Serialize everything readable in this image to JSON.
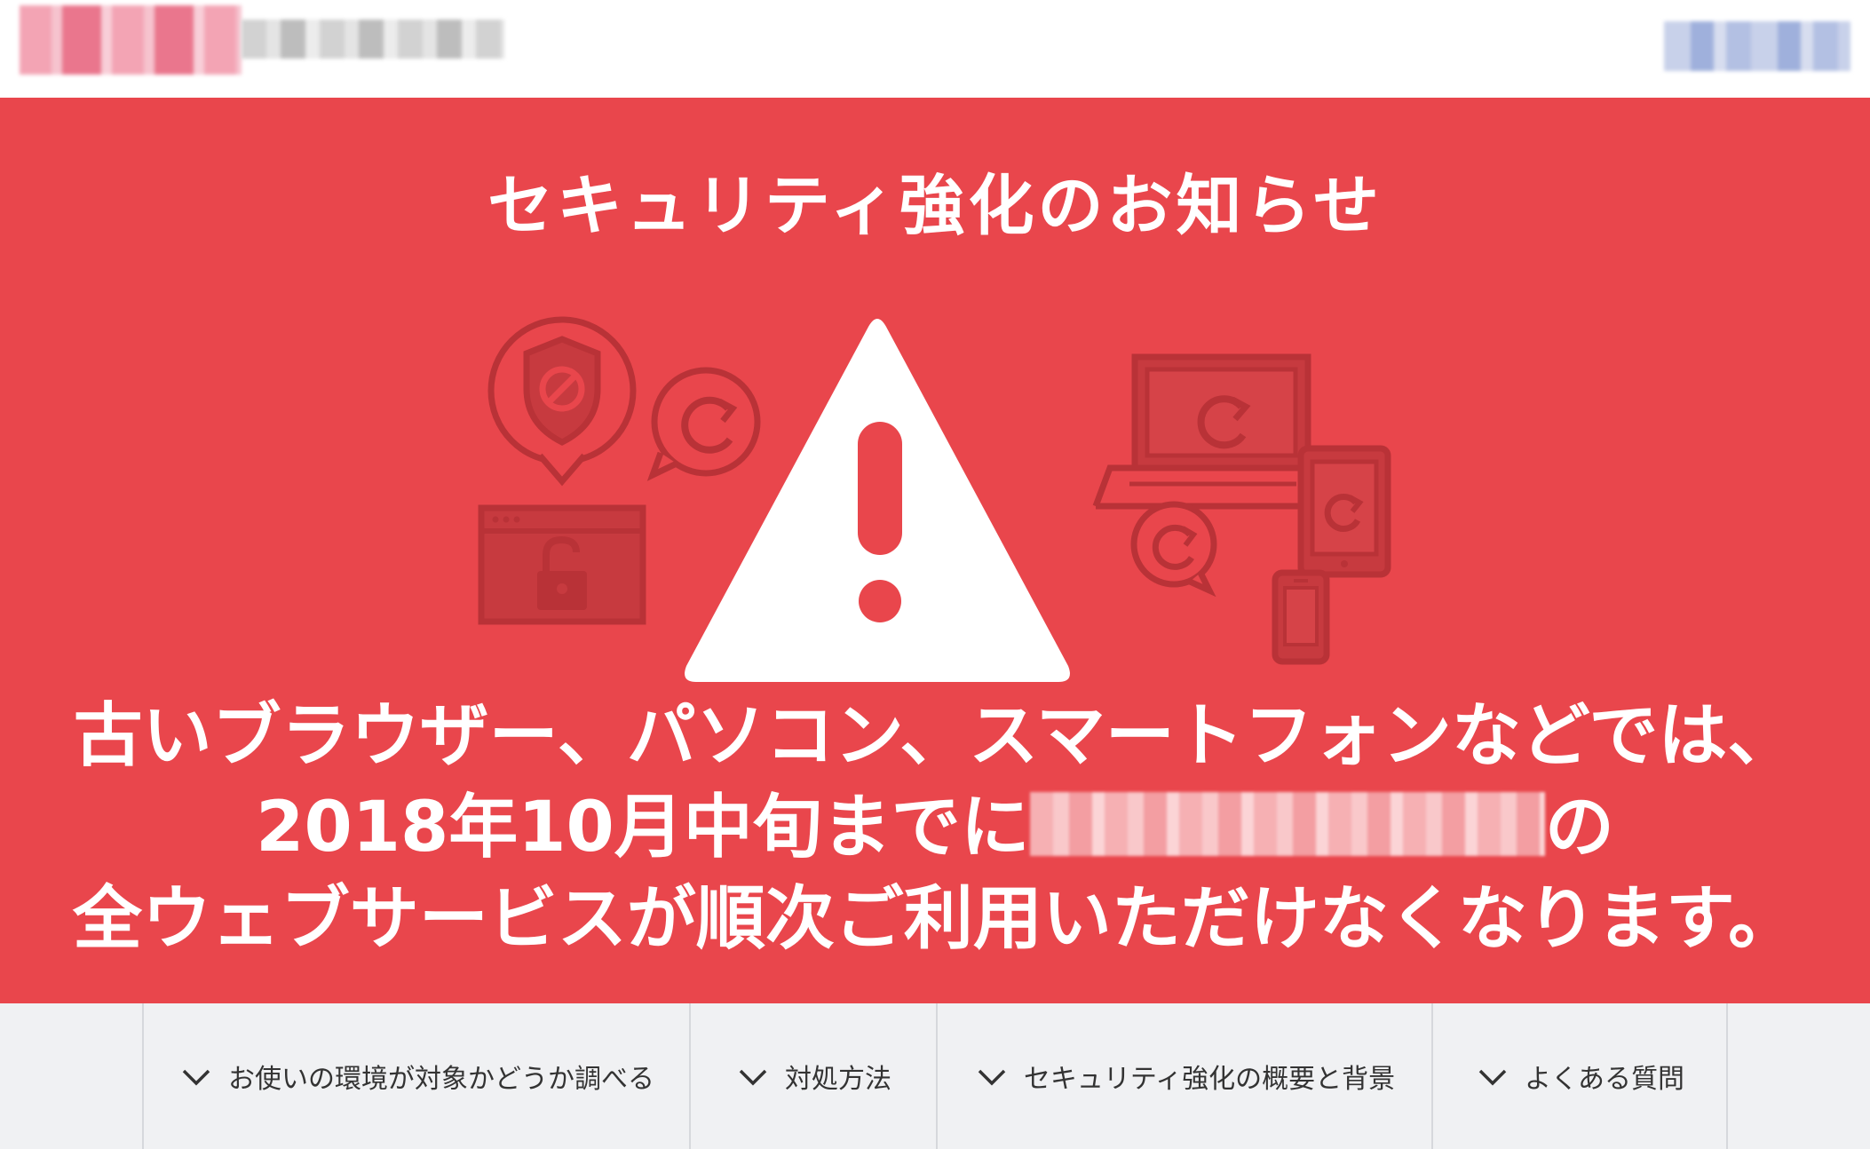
{
  "header": {
    "logo_redacted": "",
    "account_redacted": ""
  },
  "hero": {
    "title": "セキュリティ強化のお知らせ",
    "message_line1": "古いブラウザー、パソコン、スマートフォンなどでは、",
    "message_line2_before": "2018年10月中旬までに",
    "message_line2_after": "の",
    "message_line3": "全ウェブサービスが順次ご利用いただけなくなります。",
    "colors": {
      "background": "#e9464c",
      "icon_dark": "#b93237",
      "text": "#ffffff"
    }
  },
  "nav": {
    "items": [
      {
        "label": "お使いの環境が対象かどうか調べる",
        "icon": "chevron-down-icon"
      },
      {
        "label": "対処方法",
        "icon": "chevron-down-icon"
      },
      {
        "label": "セキュリティ強化の概要と背景",
        "icon": "chevron-down-icon"
      },
      {
        "label": "よくある質問",
        "icon": "chevron-down-icon"
      }
    ]
  }
}
